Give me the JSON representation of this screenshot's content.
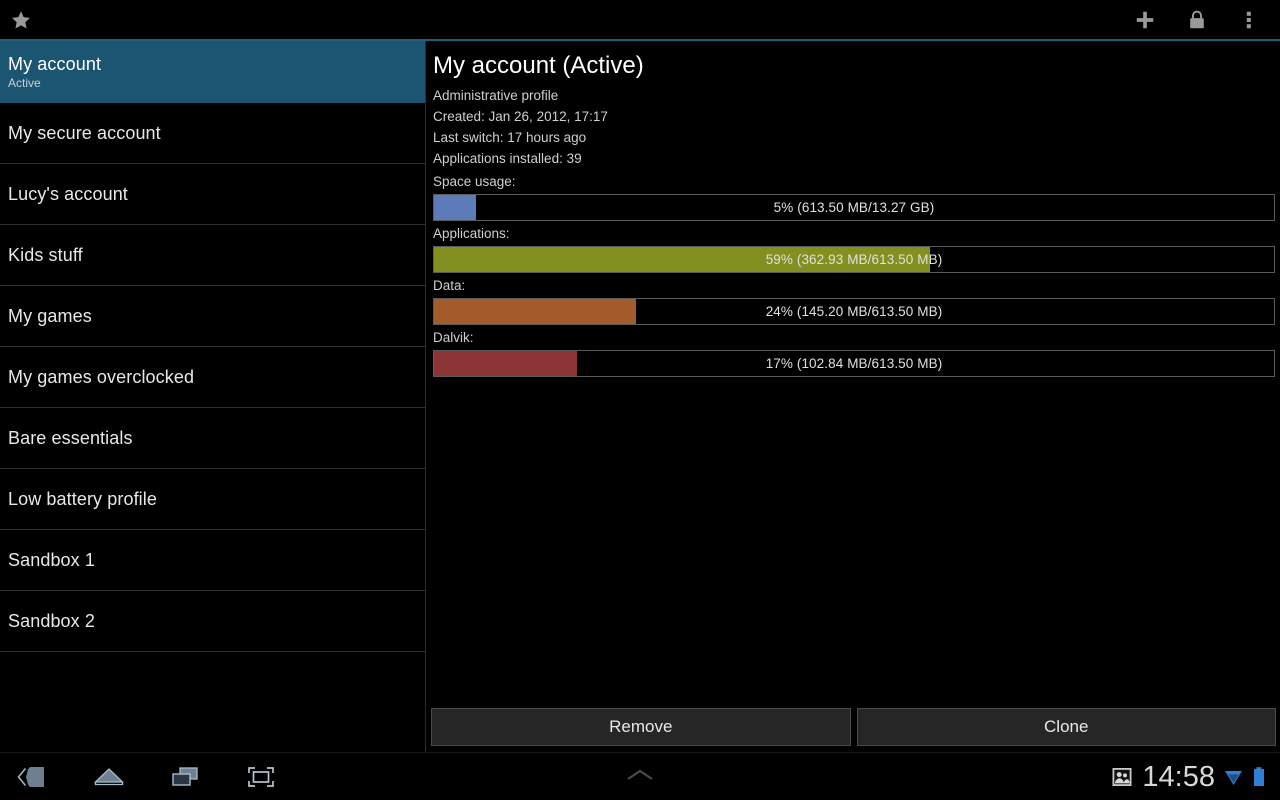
{
  "actionbar": {
    "star_icon": "star-icon",
    "add_icon": "plus-icon",
    "lock_icon": "lock-icon",
    "overflow_icon": "overflow-menu-icon",
    "accent_color": "#1f5f80"
  },
  "sidebar": {
    "items": [
      {
        "label": "My account",
        "sub": "Active",
        "selected": true
      },
      {
        "label": "My secure account",
        "sub": "",
        "selected": false
      },
      {
        "label": "Lucy's account",
        "sub": "",
        "selected": false
      },
      {
        "label": "Kids stuff",
        "sub": "",
        "selected": false
      },
      {
        "label": "My games",
        "sub": "",
        "selected": false
      },
      {
        "label": "My games overclocked",
        "sub": "",
        "selected": false
      },
      {
        "label": "Bare essentials",
        "sub": "",
        "selected": false
      },
      {
        "label": "Low battery profile",
        "sub": "",
        "selected": false
      },
      {
        "label": "Sandbox 1",
        "sub": "",
        "selected": false
      },
      {
        "label": "Sandbox 2",
        "sub": "",
        "selected": false
      }
    ],
    "selected_color": "#1b5572"
  },
  "detail": {
    "title": "My account (Active)",
    "info_lines": [
      "Administrative profile",
      "Created: Jan 26, 2012, 17:17",
      "Last switch: 17 hours ago",
      "Applications installed: 39"
    ],
    "bars": [
      {
        "label": "Space usage:",
        "text": "5% (613.50 MB/13.27 GB)",
        "percent": 5,
        "color": "#5b7cb8"
      },
      {
        "label": "Applications:",
        "text": "59% (362.93 MB/613.50 MB)",
        "percent": 59,
        "color": "#82901f"
      },
      {
        "label": "Data:",
        "text": "24% (145.20 MB/613.50 MB)",
        "percent": 24,
        "color": "#a45c2c"
      },
      {
        "label": "Dalvik:",
        "text": "17% (102.84 MB/613.50 MB)",
        "percent": 17,
        "color": "#8a3435"
      }
    ],
    "remove_label": "Remove",
    "clone_label": "Clone"
  },
  "navbar": {
    "back_icon": "back-icon",
    "home_icon": "home-icon",
    "recents_icon": "recent-apps-icon",
    "screenshot_icon": "screenshot-icon",
    "drawer_handle_icon": "chevron-up-icon",
    "contacts_icon": "contacts-icon",
    "clock": "14:58",
    "wifi_icon": "wifi-icon",
    "battery_icon": "battery-icon"
  }
}
